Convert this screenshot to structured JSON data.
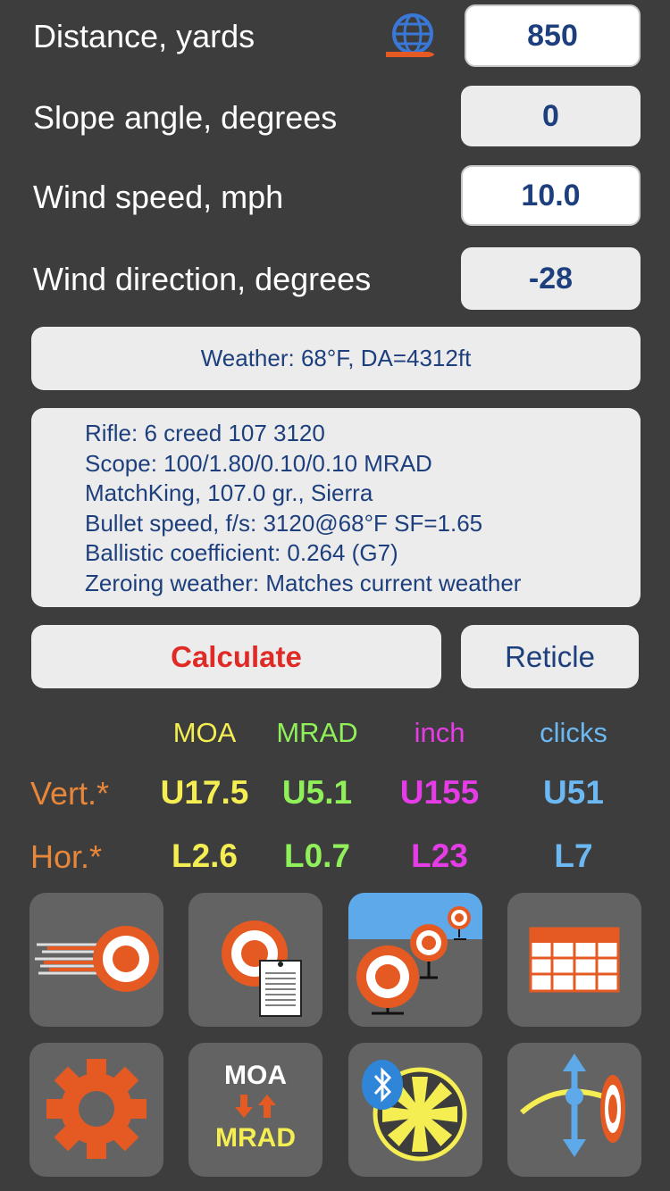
{
  "inputs": [
    {
      "label": "Distance, yards",
      "value": "850"
    },
    {
      "label": "Slope angle, degrees",
      "value": "0"
    },
    {
      "label": "Wind speed, mph",
      "value": "10.0"
    },
    {
      "label": "Wind direction, degrees",
      "value": "-28"
    }
  ],
  "weather": "Weather: 68°F, DA=4312ft",
  "rifle_info": [
    "Rifle: 6 creed 107 3120",
    "Scope: 100/1.80/0.10/0.10 MRAD",
    "MatchKing, 107.0 gr., Sierra",
    "Bullet speed, f/s: 3120@68°F SF=1.65",
    "Ballistic coefficient: 0.264 (G7)",
    "Zeroing weather: Matches current weather"
  ],
  "buttons": {
    "calculate": "Calculate",
    "reticle": "Reticle"
  },
  "results": {
    "units": [
      "MOA",
      "MRAD",
      "inch",
      "clicks"
    ],
    "vertical_label": "Vert.*",
    "horizontal_label": "Hor.*",
    "vertical": [
      "U17.5",
      "U5.1",
      "U155",
      "U51"
    ],
    "horizontal": [
      "L2.6",
      "L0.7",
      "L23",
      "L7"
    ]
  },
  "colors": {
    "moa": "#f4ee52",
    "mrad": "#90f05a",
    "inch": "#e63ce8",
    "clicks": "#6cb8f2",
    "row_label": "#e8863a",
    "calculate": "#e02a26",
    "field_text": "#1d3f7d"
  },
  "tools": {
    "row1_icons": [
      "ballistics-target-icon",
      "target-card-icon",
      "range-targets-icon",
      "table-icon"
    ],
    "row2_icons": [
      "gear-icon",
      "moa-mrad-converter-icon",
      "bluetooth-wind-meter-icon",
      "trajectory-icon"
    ],
    "converter_top": "MOA",
    "converter_bottom": "MRAD"
  }
}
